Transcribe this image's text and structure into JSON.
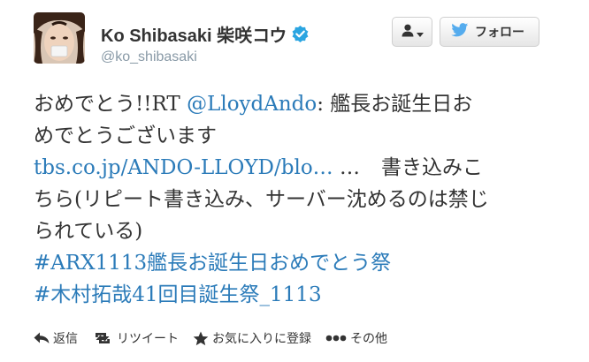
{
  "user": {
    "name": "Ko Shibasaki 柴咲コウ",
    "screen_name": "@ko_shibasaki",
    "verified": true
  },
  "buttons": {
    "follow_label": "フォロー"
  },
  "tweet": {
    "line1_prefix": "おめでとう!!RT ",
    "mention": "@LloydAndo",
    "line1_suffix": ": 艦長お誕生日お",
    "line2": "めでとうございます",
    "link": "tbs.co.jp/ANDO-LLOYD/blo…",
    "line3_ellipsis": " …",
    "line3_suffix": "書き込みこ",
    "line4": "ちら(リピート書き込み、サーバー沈めるのは禁じ",
    "line5": "られている)",
    "hashtag1": "#ARX1113艦長お誕生日おめでとう祭",
    "hashtag2": "#木村拓哉41回目誕生祭_1113"
  },
  "actions": {
    "reply": "返信",
    "retweet": "リツイート",
    "favorite": "お気に入りに登録",
    "more": "その他"
  },
  "colors": {
    "link": "#2b7bb9",
    "text": "#333333",
    "muted": "#8899a6",
    "twitter_blue": "#55acee",
    "verified_blue": "#1da1f2"
  }
}
